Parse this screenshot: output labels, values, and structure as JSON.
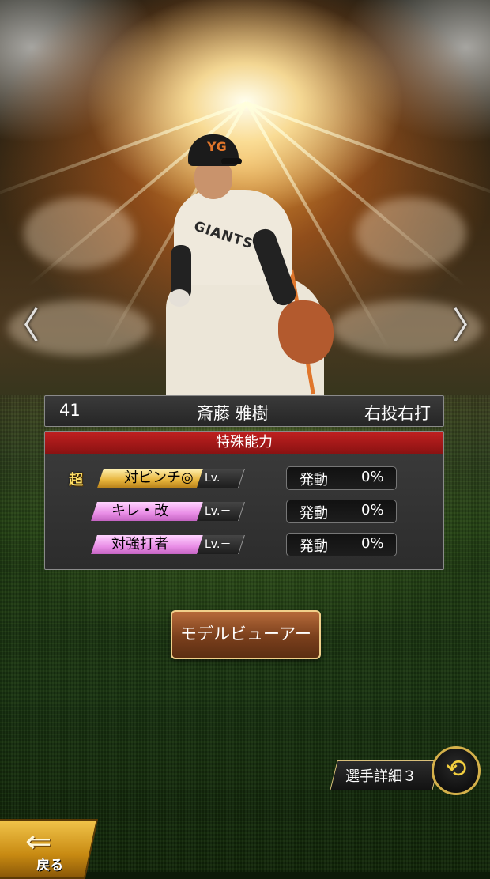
{
  "player": {
    "number": "41",
    "name": "斎藤 雅樹",
    "hand": "右投右打",
    "jersey_text": "GIANTS",
    "cap_logo": "YG"
  },
  "abilities": {
    "header": "特殊能力",
    "items": [
      {
        "chip": "超",
        "name": "対ピンチ◎",
        "lv": "Lv.－",
        "act_label": "発動",
        "act_value": "0%",
        "color": "gold"
      },
      {
        "chip": "",
        "name": "キレ・改",
        "lv": "Lv.－",
        "act_label": "発動",
        "act_value": "0%",
        "color": "pink"
      },
      {
        "chip": "",
        "name": "対強打者",
        "lv": "Lv.－",
        "act_label": "発動",
        "act_value": "0%",
        "color": "pink"
      }
    ]
  },
  "buttons": {
    "model_viewer": "モデルビューアー",
    "player_detail": "選手詳細３",
    "back": "戻る"
  },
  "nav": {
    "prev_icon": "chevron-left-icon",
    "next_icon": "chevron-right-icon",
    "prev_glyph": "〈",
    "next_glyph": "〉",
    "switch_glyph": "⟲",
    "back_glyph": "⇐"
  },
  "colors": {
    "header_red": "#b01a1a",
    "gold_chip": "#e7b43b",
    "pink_chip": "#e98ee6",
    "button_brown": "#7a3f1c"
  }
}
